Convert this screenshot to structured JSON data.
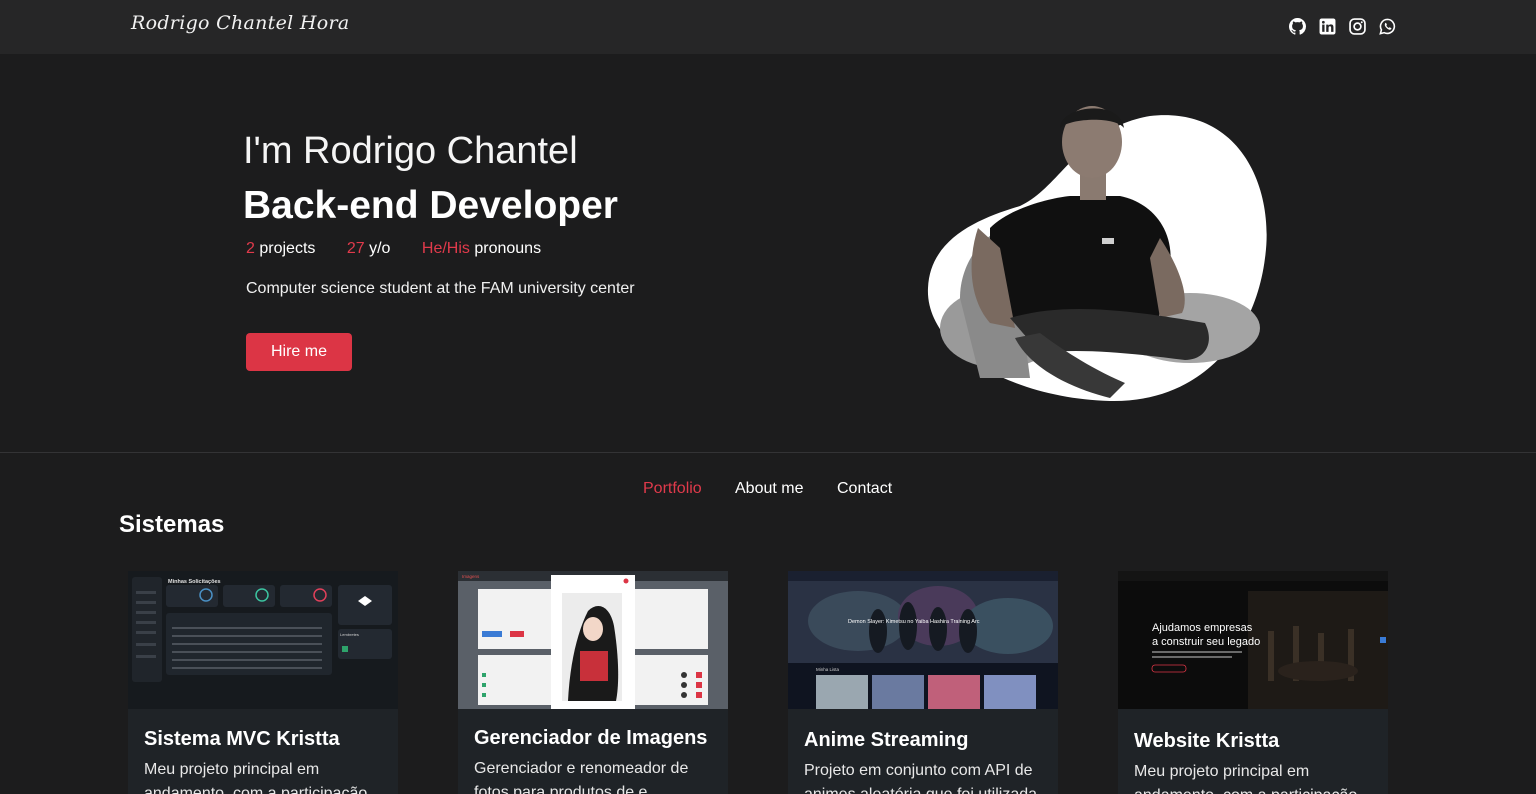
{
  "nav": {
    "brand": "Rodrigo Chantel Hora",
    "social_icons": [
      "github-icon",
      "linkedin-icon",
      "instagram-icon",
      "whatsapp-icon"
    ]
  },
  "hero": {
    "greeting": "I'm Rodrigo Chantel",
    "role": "Back-end Developer",
    "stats": [
      {
        "value": "2",
        "label": "projects"
      },
      {
        "value": "27",
        "label": "y/o"
      },
      {
        "value": "He/His",
        "label": "pronouns"
      }
    ],
    "description": "Computer science student at the FAM university center",
    "hire_label": "Hire me"
  },
  "section_nav": {
    "portfolio": "Portfolio",
    "about": "About me",
    "contact": "Contact",
    "active": "Portfolio"
  },
  "section_title": "Sistemas",
  "cards": [
    {
      "title": "Sistema MVC Kristta",
      "description": "Meu projeto principal em andamento, com a participação",
      "thumb_texts": [
        "Minhas Solicitações",
        "Lembretes"
      ]
    },
    {
      "title": "Gerenciador de Imagens",
      "description": "Gerenciador e renomeador de fotos para produtos de e",
      "thumb_texts": [
        "Imagens"
      ]
    },
    {
      "title": "Anime Streaming",
      "description": "Projeto em conjunto com API de animes aleatória que foi utilizada",
      "thumb_texts": [
        "Demon Slayer: Kimetsu no Yaiba Hashira Training Arc",
        "Minha Lista"
      ]
    },
    {
      "title": "Website Kristta",
      "description": "Meu projeto principal em andamento, com a participação",
      "thumb_texts": [
        "Ajudamos empresas",
        "a construir seu legado"
      ]
    }
  ],
  "colors": {
    "accent": "#dc3545",
    "background": "#1c1c1d",
    "navbar": "#262627",
    "card": "#1f2327"
  }
}
